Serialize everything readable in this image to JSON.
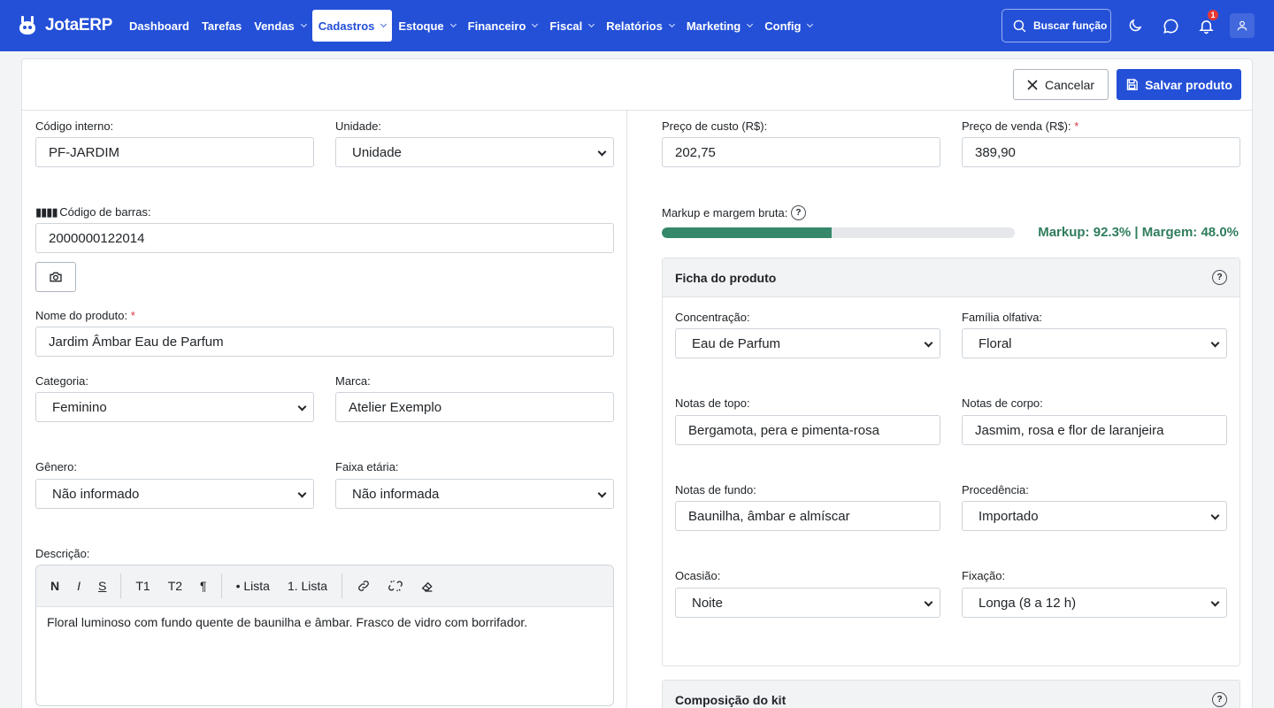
{
  "brand": {
    "name": "JotaERP"
  },
  "nav": {
    "items": [
      {
        "label": "Dashboard",
        "dropdown": false,
        "active": false
      },
      {
        "label": "Tarefas",
        "dropdown": false,
        "active": false
      },
      {
        "label": "Vendas",
        "dropdown": true,
        "active": false
      },
      {
        "label": "Cadastros",
        "dropdown": true,
        "active": true
      },
      {
        "label": "Estoque",
        "dropdown": true,
        "active": false
      },
      {
        "label": "Financeiro",
        "dropdown": true,
        "active": false
      },
      {
        "label": "Fiscal",
        "dropdown": true,
        "active": false
      },
      {
        "label": "Relatórios",
        "dropdown": true,
        "active": false
      },
      {
        "label": "Marketing",
        "dropdown": true,
        "active": false
      },
      {
        "label": "Config",
        "dropdown": true,
        "active": false
      }
    ],
    "search_label": "Buscar função",
    "notification_count": "1",
    "icons": [
      "search-icon",
      "moon-icon",
      "chat-icon",
      "bell-icon",
      "user-icon"
    ]
  },
  "actions": {
    "cancel_label": "Cancelar",
    "save_label": "Salvar produto"
  },
  "form": {
    "codigo_interno": {
      "label": "Código interno:",
      "value": "PF-JARDIM"
    },
    "unidade": {
      "label": "Unidade:",
      "value": "Unidade"
    },
    "codigo_barras": {
      "label": "Código de barras:",
      "value": "2000000122014"
    },
    "nome": {
      "label": "Nome do produto:",
      "value": "Jardim Âmbar Eau de Parfum"
    },
    "categoria": {
      "label": "Categoria:",
      "value": "Feminino"
    },
    "marca": {
      "label": "Marca:",
      "value": "Atelier Exemplo"
    },
    "genero": {
      "label": "Gênero:",
      "value": "Não informado"
    },
    "faixa_etaria": {
      "label": "Faixa etária:",
      "value": "Não informada"
    },
    "descricao": {
      "label": "Descrição:",
      "toolbar": {
        "bold": "N",
        "italic": "I",
        "strike": "S",
        "h1": "T1",
        "h2": "T2",
        "para": "¶",
        "bullet": "• Lista",
        "ordered": "1. Lista"
      },
      "text": "Floral luminoso com fundo quente de baunilha e âmbar. Frasco de vidro com borrifador."
    }
  },
  "pricing": {
    "custo": {
      "label": "Preço de custo (R$):",
      "value": "202,75"
    },
    "venda": {
      "label": "Preço de venda (R$):",
      "value": "389,90"
    },
    "markup_label": "Markup e margem bruta:",
    "markup_text": "Markup: 92.3% | Margem: 48.0%",
    "margin_fraction": 0.48,
    "bar_color": "#35886a"
  },
  "ficha": {
    "title": "Ficha do produto",
    "concentracao": {
      "label": "Concentração:",
      "value": "Eau de Parfum"
    },
    "familia": {
      "label": "Família olfativa:",
      "value": "Floral"
    },
    "topo": {
      "label": "Notas de topo:",
      "value": "Bergamota, pera e pimenta-rosa"
    },
    "corpo": {
      "label": "Notas de corpo:",
      "value": "Jasmim, rosa e flor de laranjeira"
    },
    "fundo": {
      "label": "Notas de fundo:",
      "value": "Baunilha, âmbar e almíscar"
    },
    "procedencia": {
      "label": "Procedência:",
      "value": "Importado"
    },
    "ocasiao": {
      "label": "Ocasião:",
      "value": "Noite"
    },
    "fixacao": {
      "label": "Fixação:",
      "value": "Longa (8 a 12 h)"
    }
  },
  "kit": {
    "title": "Composição do kit"
  },
  "colors": {
    "brand": "#2450d8",
    "success": "#2f7d5d",
    "danger": "#e53935"
  }
}
